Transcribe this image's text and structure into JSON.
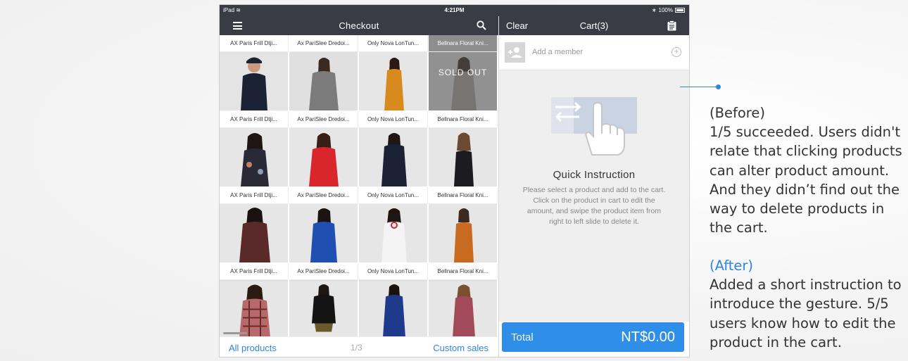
{
  "status_bar": {
    "device": "iPad",
    "time": "4:21PM",
    "battery": "100%"
  },
  "left_nav": {
    "title": "Checkout"
  },
  "right_nav": {
    "clear_label": "Clear",
    "title": "Cart(3)"
  },
  "products": {
    "names": [
      "AX Paris Frill Dtji...",
      "Ax PariSlee Dredoi...",
      "Only Nova LonTun...",
      "Bellnara Floral Kni..."
    ],
    "sold_out_label": "SOLD OUT"
  },
  "bottom_bar": {
    "all_products": "All products",
    "page": "1/3",
    "custom_sales": "Custom sales"
  },
  "cart": {
    "member_placeholder": "Add a member",
    "instruction_title": "Quick Instruction",
    "instruction_text": "Please select a product and add to the cart. Click on the product in cart to edit the amount, and swipe the product item from right to left slide to delete it.",
    "total_label": "Total",
    "total_amount": "NT$0.00"
  },
  "annotation": {
    "before_heading": "(Before)",
    "before_text": "1/5 succeeded. Users didn't relate that clicking products can alter product amount. And they didn’t find out the way to delete products in the cart.",
    "after_heading": "(After)",
    "after_text": "Added a short instruction to introduce the gesture. 5/5 users know how to edit the product in the cart."
  },
  "colors": {
    "nav_bg": "#3a3c45",
    "accent": "#2e86de",
    "total_bg": "#2f8fe8"
  }
}
